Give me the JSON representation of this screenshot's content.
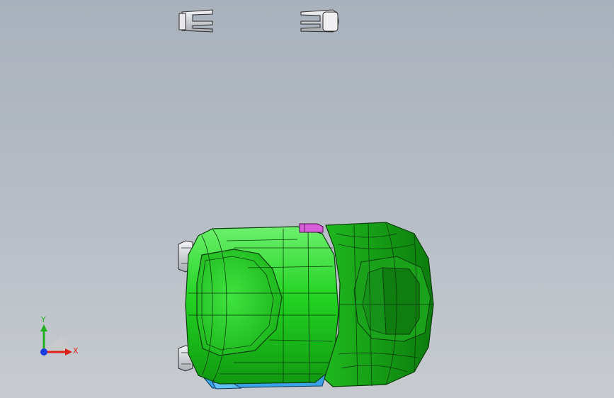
{
  "viewport": {
    "background_top": "#a9b1bc",
    "background_bottom": "#c7cbd0"
  },
  "model": {
    "body_color": "#1fd21f",
    "body_dark": "#138f13",
    "edge_color": "#0b3d0b",
    "chassis_color": "#3aa3e8",
    "accent_part_color": "#d860d8",
    "wheel_color": "#e4e6ea"
  },
  "triad": {
    "x_label": "X",
    "y_label": "Y",
    "x_color": "#e0201a",
    "y_color": "#22b020",
    "origin_color": "#1a3ce0"
  }
}
